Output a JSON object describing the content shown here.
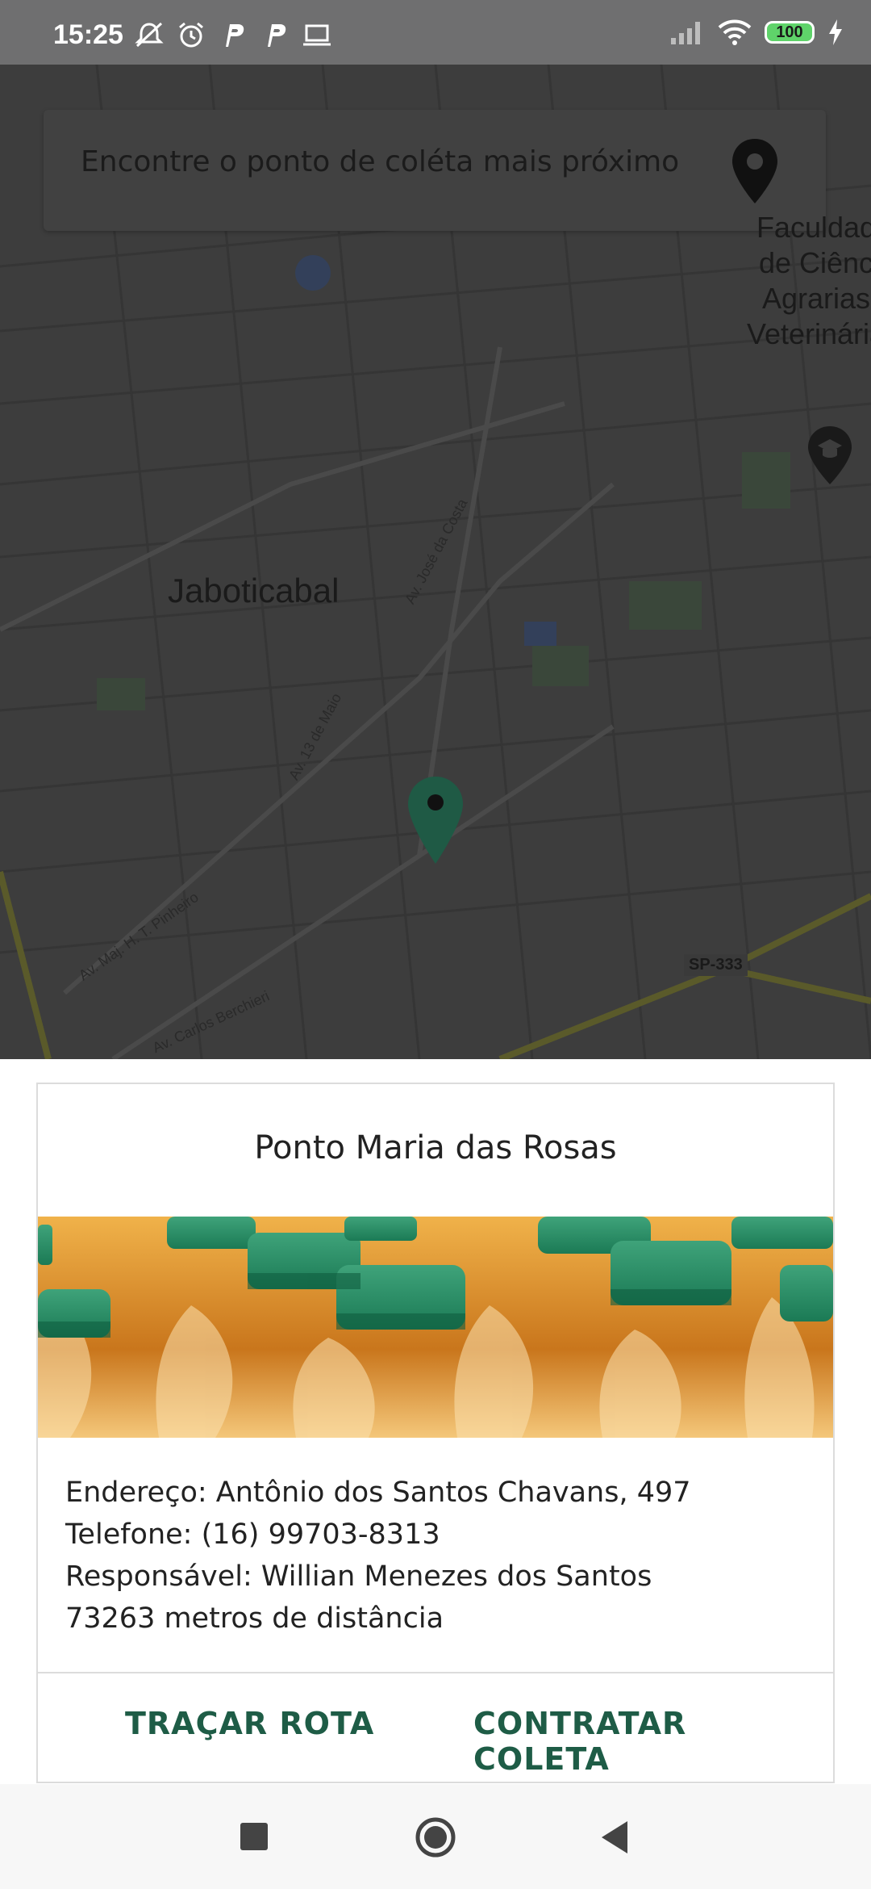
{
  "status_bar": {
    "time": "15:25",
    "left_icons": [
      "mute-icon",
      "alarm-icon",
      "parking-icon",
      "parking-icon",
      "laptop-icon"
    ],
    "right_icons": [
      "signal-icon",
      "wifi-icon",
      "battery-icon",
      "charging-icon"
    ],
    "battery_level": "100"
  },
  "map": {
    "search_placeholder": "Encontre o ponto de coléta mais próximo",
    "city_label": "Jaboticabal",
    "poi_label_lines": [
      "Faculdad",
      "de Ciênc",
      "Agrarias",
      "Veterinária"
    ],
    "streets": {
      "jose_da_costa": "Av. José da Costa",
      "treze_de_maio": "Av. 13 de Maio",
      "pinheiro": "Av. Maj. H. T. Pinheiro",
      "berchieri": "Av. Carlos Berchieri",
      "highway": "SP-333"
    }
  },
  "card": {
    "title": "Ponto Maria das Rosas",
    "image_description_icon": "oil-bottles-image",
    "address": "Endereço: Antônio dos Santos Chavans, 497",
    "phone": "Telefone: (16) 99703-8313",
    "responsible": "Responsável: Willian Menezes dos Santos",
    "distance": "73263 metros de distância",
    "route_button": "TRAÇAR ROTA",
    "hire_button": "CONTRATAR COLETA"
  },
  "colors": {
    "accent": "#1e5c46",
    "marker": "#1f5a45",
    "map_overlay": "#3d3d3d"
  },
  "nav_bar": {
    "buttons": [
      "recent-apps-icon",
      "home-icon",
      "back-icon"
    ]
  }
}
